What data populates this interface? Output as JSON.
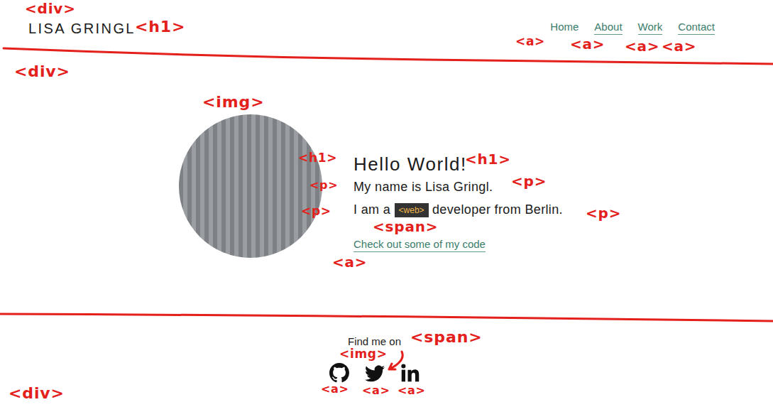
{
  "header": {
    "title": "LISA GRINGL",
    "nav": [
      {
        "label": "Home",
        "selected": true
      },
      {
        "label": "About",
        "selected": false
      },
      {
        "label": "Work",
        "selected": false
      },
      {
        "label": "Contact",
        "selected": false
      }
    ]
  },
  "hero": {
    "heading": "Hello World!",
    "intro": "My name is Lisa Gringl.",
    "line": {
      "before": "I am a ",
      "tag": "<web>",
      "after": " developer from Berlin."
    },
    "link": "Check out some of my code"
  },
  "footer": {
    "label": "Find me on"
  },
  "annotations": [
    {
      "text": "<div>"
    },
    {
      "text": "<h1>"
    },
    {
      "text": "<a>"
    },
    {
      "text": "<a>"
    },
    {
      "text": "<a>"
    },
    {
      "text": "<a>"
    },
    {
      "text": "<div>"
    },
    {
      "text": "<img>"
    },
    {
      "text": "<h1>"
    },
    {
      "text": "<h1>"
    },
    {
      "text": "<p>"
    },
    {
      "text": "<p>"
    },
    {
      "text": "<p>"
    },
    {
      "text": "<p>"
    },
    {
      "text": "<span>"
    },
    {
      "text": "<a>"
    },
    {
      "text": "<span>"
    },
    {
      "text": "<img>"
    },
    {
      "text": "<a>"
    },
    {
      "text": "<a>"
    },
    {
      "text": "<a>"
    },
    {
      "text": "<div>"
    }
  ]
}
